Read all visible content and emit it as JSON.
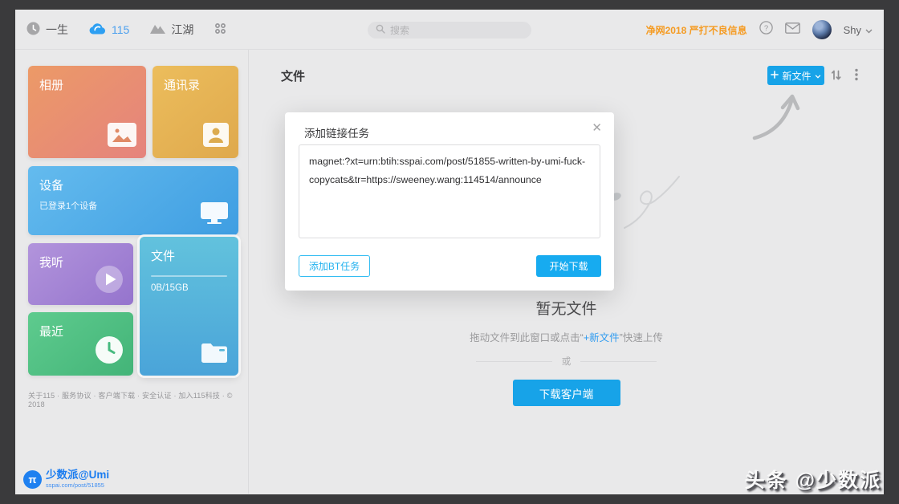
{
  "colors": {
    "frame": "#3a3a3c",
    "background": "#e9e9ea",
    "brand_blue": "#17a3e8",
    "nav_active_blue": "#4a9fee",
    "notice_orange": "#f59b22"
  },
  "navbar": {
    "items": [
      {
        "label": "一生"
      },
      {
        "label": "115"
      },
      {
        "label": "江湖"
      }
    ],
    "search_placeholder": "搜索",
    "notice": "净网2018 严打不良信息",
    "username": "Shy"
  },
  "sidebar": {
    "tiles": {
      "albums": {
        "label": "相册"
      },
      "contacts": {
        "label": "通讯录"
      },
      "devices": {
        "label": "设备",
        "subtitle": "已登录1个设备"
      },
      "listen": {
        "label": "我听"
      },
      "files": {
        "label": "文件",
        "quota": "0B/15GB"
      },
      "recent": {
        "label": "最近"
      }
    },
    "footer": "关于115 · 服务协议 · 客户端下载 · 安全认证 · 加入115科技 · © 2018",
    "branding": {
      "name": "少数派@Umi",
      "url": "sspai.com/post/51855",
      "logo": "π"
    }
  },
  "main": {
    "title": "文件",
    "new_file_label": "新文件",
    "empty": {
      "title": "暂无文件",
      "hint_prefix": "拖动文件到此窗口或点击“",
      "hint_link": "+新文件",
      "hint_suffix": "”快速上传",
      "divider": "或",
      "download_button": "下载客户端"
    }
  },
  "modal": {
    "title": "添加链接任务",
    "close": "✕",
    "input_value": "magnet:?xt=urn:btih:sspai.com/post/51855-written-by-umi-fuck-copycats&tr=https://sweeney.wang:114514/announce",
    "add_bt_button": "添加BT任务",
    "start_button": "开始下载"
  },
  "watermark": "头条 @少数派"
}
